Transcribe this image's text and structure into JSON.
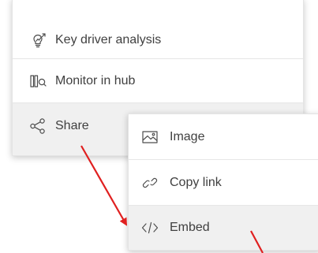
{
  "context_menu": {
    "items": [
      {
        "label": "Key driver analysis",
        "icon": "lightbulb-icon"
      },
      {
        "label": "Monitor in hub",
        "icon": "monitor-hub-icon"
      },
      {
        "label": "Share",
        "icon": "share-icon",
        "state": "hovered"
      }
    ]
  },
  "share_submenu": {
    "items": [
      {
        "label": "Image",
        "icon": "image-icon"
      },
      {
        "label": "Copy link",
        "icon": "link-icon"
      },
      {
        "label": "Embed",
        "icon": "code-icon",
        "state": "hovered"
      }
    ]
  },
  "colors": {
    "menu_text": "#404040",
    "icon_stroke": "#4d4d4d",
    "hover_background": "#f0f0f0",
    "annotation_arrow": "#e02020"
  }
}
